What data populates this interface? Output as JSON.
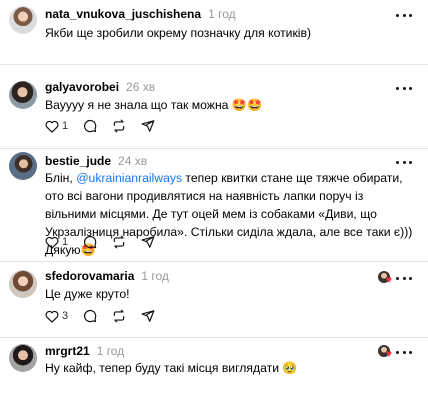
{
  "comments": [
    {
      "username": "nata_vnukova_juschishena",
      "time": "1 год",
      "text": "Якби ще зробили окрему позначку для котиків)",
      "likes": "",
      "replies": ""
    },
    {
      "username": "galyavorobei",
      "time": "26 хв",
      "text": "Вауууу я не знала що так можна 🤩🤩",
      "likes": "1",
      "replies": ""
    },
    {
      "username": "bestie_jude",
      "time": "24 хв",
      "text_before": "Блін, ",
      "mention": "@ukrainianrailways",
      "text_after": " тепер квитки стане ще тяжче обирати, ото всі вагони продивлятися на наявність лапки поруч із вільними місцями. Де тут оцей мем із собаками «Диви, що Укрзалізниця наробила». Стільки сиділа ждала, але все таки є))) Дякую🤩",
      "likes": "1",
      "replies": ""
    },
    {
      "username": "sfedorovamaria",
      "time": "1 год",
      "text": "Це дуже круто!",
      "likes": "3",
      "replies": ""
    },
    {
      "username": "mrgrt21",
      "time": "1 год",
      "text": "Ну кайф, тепер буду такі місця виглядати 🥹",
      "likes": "",
      "replies": ""
    }
  ],
  "icons": {
    "like": "heart-icon",
    "reply": "comment-icon",
    "repost": "repost-icon",
    "share": "share-icon",
    "more": "more-icon",
    "liked_by_author": "author-liked-icon"
  },
  "colors": {
    "mention": "#1877f2",
    "time": "#999999",
    "divider": "#e5e5e5",
    "heart": "#ff3040"
  }
}
